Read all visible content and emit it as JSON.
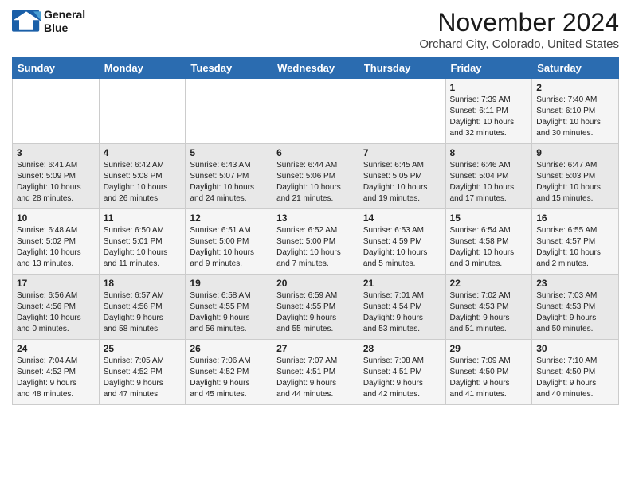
{
  "header": {
    "logo_line1": "General",
    "logo_line2": "Blue",
    "month": "November 2024",
    "location": "Orchard City, Colorado, United States"
  },
  "weekdays": [
    "Sunday",
    "Monday",
    "Tuesday",
    "Wednesday",
    "Thursday",
    "Friday",
    "Saturday"
  ],
  "weeks": [
    [
      {
        "day": "",
        "info": ""
      },
      {
        "day": "",
        "info": ""
      },
      {
        "day": "",
        "info": ""
      },
      {
        "day": "",
        "info": ""
      },
      {
        "day": "",
        "info": ""
      },
      {
        "day": "1",
        "info": "Sunrise: 7:39 AM\nSunset: 6:11 PM\nDaylight: 10 hours\nand 32 minutes."
      },
      {
        "day": "2",
        "info": "Sunrise: 7:40 AM\nSunset: 6:10 PM\nDaylight: 10 hours\nand 30 minutes."
      }
    ],
    [
      {
        "day": "3",
        "info": "Sunrise: 6:41 AM\nSunset: 5:09 PM\nDaylight: 10 hours\nand 28 minutes."
      },
      {
        "day": "4",
        "info": "Sunrise: 6:42 AM\nSunset: 5:08 PM\nDaylight: 10 hours\nand 26 minutes."
      },
      {
        "day": "5",
        "info": "Sunrise: 6:43 AM\nSunset: 5:07 PM\nDaylight: 10 hours\nand 24 minutes."
      },
      {
        "day": "6",
        "info": "Sunrise: 6:44 AM\nSunset: 5:06 PM\nDaylight: 10 hours\nand 21 minutes."
      },
      {
        "day": "7",
        "info": "Sunrise: 6:45 AM\nSunset: 5:05 PM\nDaylight: 10 hours\nand 19 minutes."
      },
      {
        "day": "8",
        "info": "Sunrise: 6:46 AM\nSunset: 5:04 PM\nDaylight: 10 hours\nand 17 minutes."
      },
      {
        "day": "9",
        "info": "Sunrise: 6:47 AM\nSunset: 5:03 PM\nDaylight: 10 hours\nand 15 minutes."
      }
    ],
    [
      {
        "day": "10",
        "info": "Sunrise: 6:48 AM\nSunset: 5:02 PM\nDaylight: 10 hours\nand 13 minutes."
      },
      {
        "day": "11",
        "info": "Sunrise: 6:50 AM\nSunset: 5:01 PM\nDaylight: 10 hours\nand 11 minutes."
      },
      {
        "day": "12",
        "info": "Sunrise: 6:51 AM\nSunset: 5:00 PM\nDaylight: 10 hours\nand 9 minutes."
      },
      {
        "day": "13",
        "info": "Sunrise: 6:52 AM\nSunset: 5:00 PM\nDaylight: 10 hours\nand 7 minutes."
      },
      {
        "day": "14",
        "info": "Sunrise: 6:53 AM\nSunset: 4:59 PM\nDaylight: 10 hours\nand 5 minutes."
      },
      {
        "day": "15",
        "info": "Sunrise: 6:54 AM\nSunset: 4:58 PM\nDaylight: 10 hours\nand 3 minutes."
      },
      {
        "day": "16",
        "info": "Sunrise: 6:55 AM\nSunset: 4:57 PM\nDaylight: 10 hours\nand 2 minutes."
      }
    ],
    [
      {
        "day": "17",
        "info": "Sunrise: 6:56 AM\nSunset: 4:56 PM\nDaylight: 10 hours\nand 0 minutes."
      },
      {
        "day": "18",
        "info": "Sunrise: 6:57 AM\nSunset: 4:56 PM\nDaylight: 9 hours\nand 58 minutes."
      },
      {
        "day": "19",
        "info": "Sunrise: 6:58 AM\nSunset: 4:55 PM\nDaylight: 9 hours\nand 56 minutes."
      },
      {
        "day": "20",
        "info": "Sunrise: 6:59 AM\nSunset: 4:55 PM\nDaylight: 9 hours\nand 55 minutes."
      },
      {
        "day": "21",
        "info": "Sunrise: 7:01 AM\nSunset: 4:54 PM\nDaylight: 9 hours\nand 53 minutes."
      },
      {
        "day": "22",
        "info": "Sunrise: 7:02 AM\nSunset: 4:53 PM\nDaylight: 9 hours\nand 51 minutes."
      },
      {
        "day": "23",
        "info": "Sunrise: 7:03 AM\nSunset: 4:53 PM\nDaylight: 9 hours\nand 50 minutes."
      }
    ],
    [
      {
        "day": "24",
        "info": "Sunrise: 7:04 AM\nSunset: 4:52 PM\nDaylight: 9 hours\nand 48 minutes."
      },
      {
        "day": "25",
        "info": "Sunrise: 7:05 AM\nSunset: 4:52 PM\nDaylight: 9 hours\nand 47 minutes."
      },
      {
        "day": "26",
        "info": "Sunrise: 7:06 AM\nSunset: 4:52 PM\nDaylight: 9 hours\nand 45 minutes."
      },
      {
        "day": "27",
        "info": "Sunrise: 7:07 AM\nSunset: 4:51 PM\nDaylight: 9 hours\nand 44 minutes."
      },
      {
        "day": "28",
        "info": "Sunrise: 7:08 AM\nSunset: 4:51 PM\nDaylight: 9 hours\nand 42 minutes."
      },
      {
        "day": "29",
        "info": "Sunrise: 7:09 AM\nSunset: 4:50 PM\nDaylight: 9 hours\nand 41 minutes."
      },
      {
        "day": "30",
        "info": "Sunrise: 7:10 AM\nSunset: 4:50 PM\nDaylight: 9 hours\nand 40 minutes."
      }
    ]
  ]
}
